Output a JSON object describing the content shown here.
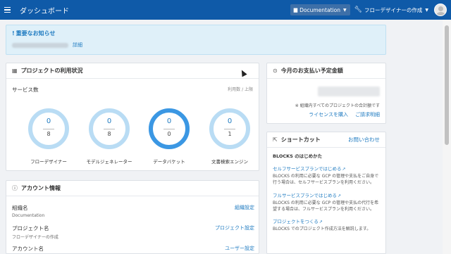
{
  "header": {
    "title": "ダッシュボード",
    "workspace_label": "Documentation",
    "project_label": "フローデザイナーの作成"
  },
  "notice": {
    "title": "重要なお知らせ",
    "link": "詳細"
  },
  "usage": {
    "title": "プロジェクトの利用状況",
    "subtitle": "サービス数",
    "legend": "利用数 / 上限",
    "gauges": [
      {
        "name": "フローデザイナー",
        "used": "0",
        "limit": "8",
        "fill": 0.0
      },
      {
        "name": "モデルジェネレーター",
        "used": "0",
        "limit": "8",
        "fill": 0.0
      },
      {
        "name": "データバケット",
        "used": "0",
        "limit": "0",
        "fill": 1.0
      },
      {
        "name": "文書検索エンジン",
        "used": "0",
        "limit": "1",
        "fill": 0.0
      }
    ]
  },
  "payment": {
    "title": "今月のお支払い予定金額",
    "note": "※ 組織内すべてのプロジェクトの合計額です",
    "buy_license": "ライセンスを購入",
    "invoice": "ご請求明細"
  },
  "shortcut": {
    "title": "ショートカット",
    "contact": "お問い合わせ",
    "heading": "BLOCKS のはじめかた",
    "items": [
      {
        "link": "セルフサービスプランではじめる",
        "desc": "BLOCKS の利用に必要な GCP の管理や支払をご自身で行う場合は、セルフサービスプランを利用ください。"
      },
      {
        "link": "フルサービスプランではじめる",
        "desc": "BLOCKS の利用に必要な GCP の管理や支払の代行を希望する場合は、フルサービスプランを利用ください。"
      },
      {
        "link": "プロジェクトをつくる",
        "desc": "BLOCKS でのプロジェクト作成方法を解説します。"
      }
    ]
  },
  "account": {
    "title": "アカウント情報",
    "rows": [
      {
        "key": "組織名",
        "value": "Documentation",
        "action": "組織設定"
      },
      {
        "key": "プロジェクト名",
        "value": "フローデザイナーの作成",
        "action": "プロジェクト設定"
      },
      {
        "key": "アカウント名",
        "value": "",
        "action": "ユーザー設定"
      }
    ]
  },
  "colors": {
    "header": "#0f5aa8",
    "accent": "#1f7bc1",
    "gauge_track": "#b9dcf4",
    "gauge_fill": "#3b97e3"
  },
  "icons": {
    "menu": "hamburger-icon",
    "workspace": "folder-icon",
    "project": "wrench-icon",
    "usage": "grid-icon",
    "payment": "coin-icon",
    "shortcut": "external-link-icon",
    "account": "info-icon"
  }
}
